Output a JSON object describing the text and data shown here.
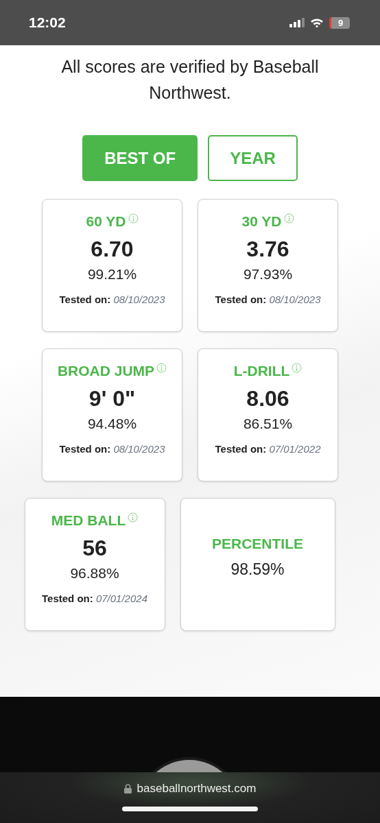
{
  "status_bar": {
    "time": "12:02",
    "battery": "9"
  },
  "notice": "All scores are verified by Baseball Northwest.",
  "tabs": [
    {
      "label": "BEST OF",
      "selected": true
    },
    {
      "label": "YEAR",
      "selected": false
    }
  ],
  "rows": [
    {
      "cards": [
        {
          "kind": "metric",
          "title": "60 YD",
          "value": "6.70",
          "percent": "99.21%",
          "tested_label": "Tested on:",
          "date": "08/10/2023"
        },
        {
          "kind": "metric",
          "title": "30 YD",
          "value": "3.76",
          "percent": "97.93%",
          "tested_label": "Tested on:",
          "date": "08/10/2023"
        }
      ]
    },
    {
      "cards": [
        {
          "kind": "metric",
          "title": "BROAD JUMP",
          "value": "9' 0\"",
          "percent": "94.48%",
          "tested_label": "Tested on:",
          "date": "08/10/2023"
        },
        {
          "kind": "metric",
          "title": "L-DRILL",
          "value": "8.06",
          "percent": "86.51%",
          "tested_label": "Tested on:",
          "date": "07/01/2022"
        }
      ]
    },
    {
      "cards": [
        {
          "kind": "metric",
          "title": "MED BALL",
          "value": "56",
          "percent": "96.88%",
          "tested_label": "Tested on:",
          "date": "07/01/2024"
        },
        {
          "kind": "summary",
          "title": "PERCENTILE",
          "percent": "98.59%"
        }
      ]
    }
  ],
  "address_bar": {
    "url": "baseballnorthwest.com"
  }
}
